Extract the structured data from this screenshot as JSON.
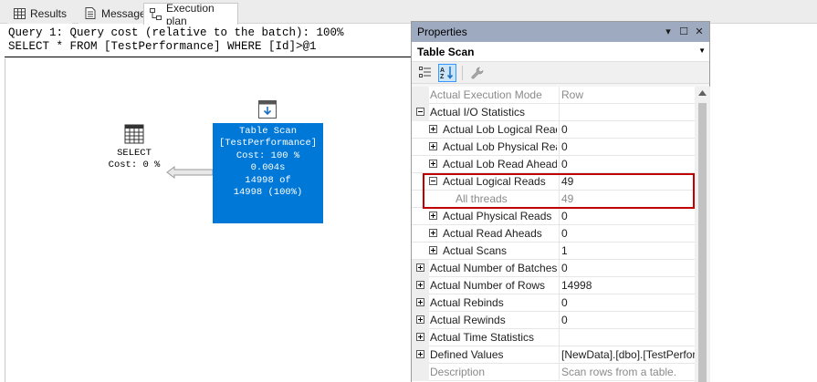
{
  "tabs": [
    {
      "label": "Results",
      "icon": "grid-icon",
      "active": false
    },
    {
      "label": "Messages",
      "icon": "message-icon",
      "active": false
    },
    {
      "label": "Execution plan",
      "icon": "execution-plan-icon",
      "active": true
    }
  ],
  "plan": {
    "query_line": "Query 1: Query cost (relative to the batch): 100%",
    "sql_line": "SELECT * FROM [TestPerformance] WHERE [Id]>@1",
    "select_node": {
      "title": "SELECT",
      "cost": "Cost: 0 %"
    },
    "scan_node": {
      "title": "Table Scan",
      "object": "[TestPerformance]",
      "cost": "Cost: 100 %",
      "time": "0.004s",
      "rows_line1": "14998 of",
      "rows_line2": "14998 (100%)"
    }
  },
  "properties": {
    "title": "Properties",
    "object": "Table Scan",
    "rows": [
      {
        "indent": 0,
        "expander": "none",
        "name": "Actual Execution Mode",
        "value": "Row",
        "grey": true
      },
      {
        "indent": 0,
        "expander": "minus",
        "name": "Actual I/O Statistics",
        "value": "",
        "grey": false
      },
      {
        "indent": 1,
        "expander": "plus",
        "name": "Actual Lob Logical Reads",
        "value": "0",
        "grey": false
      },
      {
        "indent": 1,
        "expander": "plus",
        "name": "Actual Lob Physical Reads",
        "value": "0",
        "grey": false
      },
      {
        "indent": 1,
        "expander": "plus",
        "name": "Actual Lob Read Aheads",
        "value": "0",
        "grey": false
      },
      {
        "indent": 1,
        "expander": "minus",
        "name": "Actual Logical Reads",
        "value": "49",
        "grey": false
      },
      {
        "indent": 2,
        "expander": "none",
        "name": "All threads",
        "value": "49",
        "grey": true
      },
      {
        "indent": 1,
        "expander": "plus",
        "name": "Actual Physical Reads",
        "value": "0",
        "grey": false
      },
      {
        "indent": 1,
        "expander": "plus",
        "name": "Actual Read Aheads",
        "value": "0",
        "grey": false
      },
      {
        "indent": 1,
        "expander": "plus",
        "name": "Actual Scans",
        "value": "1",
        "grey": false
      },
      {
        "indent": 0,
        "expander": "plus",
        "name": "Actual Number of Batches",
        "value": "0",
        "grey": false
      },
      {
        "indent": 0,
        "expander": "plus",
        "name": "Actual Number of Rows",
        "value": "14998",
        "grey": false
      },
      {
        "indent": 0,
        "expander": "plus",
        "name": "Actual Rebinds",
        "value": "0",
        "grey": false
      },
      {
        "indent": 0,
        "expander": "plus",
        "name": "Actual Rewinds",
        "value": "0",
        "grey": false
      },
      {
        "indent": 0,
        "expander": "plus",
        "name": "Actual Time Statistics",
        "value": "",
        "grey": false
      },
      {
        "indent": 0,
        "expander": "plus",
        "name": "Defined Values",
        "value": "[NewData].[dbo].[TestPerformance]",
        "grey": false
      },
      {
        "indent": 0,
        "expander": "none",
        "name": "Description",
        "value": "Scan rows from a table.",
        "grey": true
      }
    ]
  },
  "colors": {
    "accent": "#0078d7",
    "title_bar": "#9eaac0",
    "highlight": "#c00000"
  }
}
